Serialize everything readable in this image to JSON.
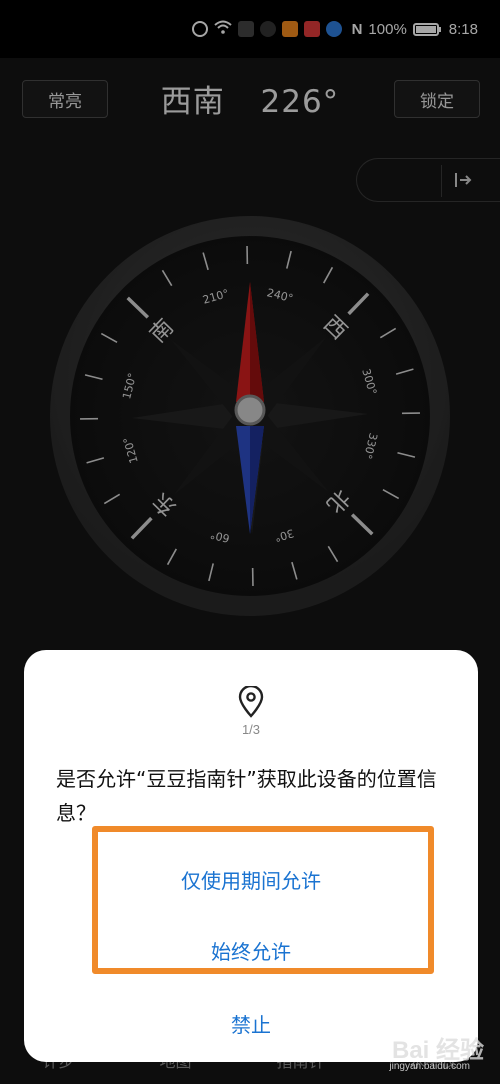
{
  "status_bar": {
    "battery_text": "100%",
    "battery_level": 1.0,
    "time": "8:18",
    "icons": [
      "alert-icon",
      "wifi-icon",
      "app-notification-icons",
      "nfc-icon",
      "battery-icon"
    ]
  },
  "compass_screen": {
    "always_on_label": "常亮",
    "direction": "西南",
    "degrees": "226°",
    "lock_label": "锁定",
    "heading_value": 226,
    "cardinals": {
      "north": "北",
      "east": "东",
      "south": "南",
      "west": "西"
    },
    "degree_labels": [
      "30°",
      "60°",
      "120°",
      "150°",
      "210°",
      "240°",
      "300°",
      "330°"
    ]
  },
  "bottom_nav": {
    "items": [
      "计步",
      "地图",
      "指南针",
      "水平仪"
    ]
  },
  "permission_dialog": {
    "counter": "1/3",
    "message": "是否允许“豆豆指南针”获取此设备的位置信息？",
    "allow_while_using": "仅使用期间允许",
    "always_allow": "始终允许",
    "deny": "禁止"
  },
  "watermark": {
    "brand": "Bai 经验",
    "url": "jingyan.baidu.com"
  },
  "colors": {
    "accent_blue": "#1a73d1",
    "highlight_orange": "#f08a2a",
    "needle_red": "#d41f1f",
    "needle_blue": "#2f4fc8"
  }
}
